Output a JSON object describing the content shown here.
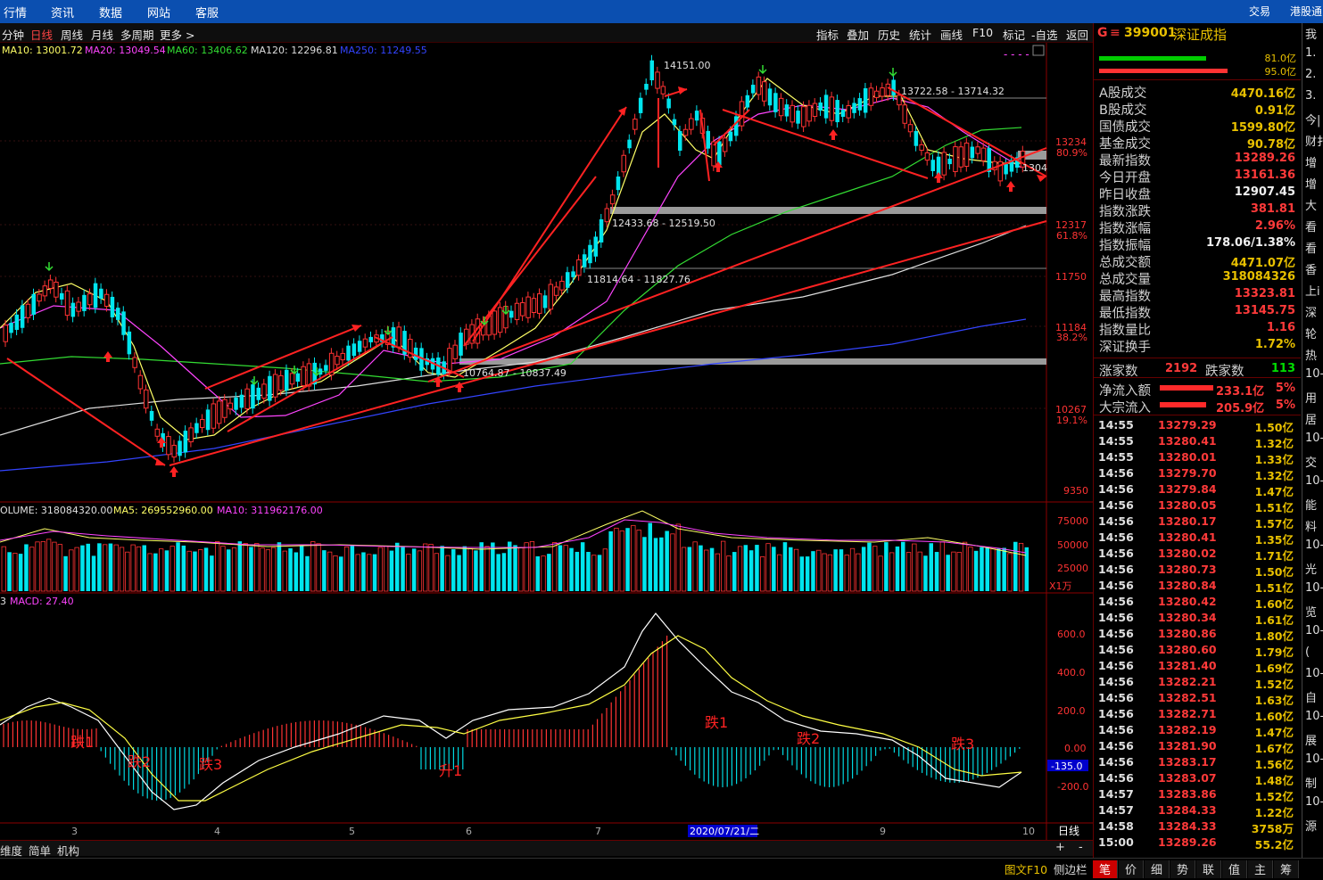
{
  "top_menu": [
    "行情",
    "资讯",
    "数据",
    "网站",
    "客服"
  ],
  "top_menu_right": [
    "交易",
    "港股通"
  ],
  "periods": [
    "分钟",
    "日线",
    "周线",
    "月线",
    "多周期",
    "更多 >"
  ],
  "active_period": "日线",
  "toolbar_right": [
    "指标",
    "叠加",
    "历史",
    "统计",
    "画线",
    "F10",
    "标记",
    "-自选",
    "返回"
  ],
  "ma_legend": [
    {
      "label": "MA10: 13001.72",
      "color": "#ffff66"
    },
    {
      "label": "MA20: 13049.54",
      "color": "#ff44ff"
    },
    {
      "label": "MA60: 13406.62",
      "color": "#33dd33"
    },
    {
      "label": "MA120: 12296.81",
      "color": "#dddddd"
    },
    {
      "label": "MA250: 11249.55",
      "color": "#3344ff"
    }
  ],
  "price_axis": [
    "13234",
    "12317",
    "11750",
    "11184",
    "10267",
    "9350"
  ],
  "fib_axis": [
    "80.9%",
    "61.8%",
    "38.2%",
    "19.1%"
  ],
  "price_annotations": [
    "14151.00",
    "13722.58 - 13714.32",
    "12433.68 - 12519.50",
    "11814.64 - 11827.76",
    "10764.87 - 10837.49",
    "1304"
  ],
  "volume_legend": [
    {
      "label": "OLUME: 318084320.00",
      "color": "#e0e0e0"
    },
    {
      "label": "MA5: 269552960.00",
      "color": "#ffff66"
    },
    {
      "label": "MA10: 311962176.00",
      "color": "#ff44ff"
    }
  ],
  "volume_axis": [
    "75000",
    "50000",
    "25000"
  ],
  "volume_unit": "X1万",
  "macd_legend": {
    "prefix": "3",
    "label": "MACD: 27.40"
  },
  "macd_axis": [
    "600.0",
    "400.0",
    "200.0",
    "0.00",
    "-200.0"
  ],
  "macd_current": "-135.0",
  "macd_annotations": [
    "跌1",
    "跌2",
    "跌3",
    "升1",
    "跌1",
    "跌2",
    "跌3"
  ],
  "date_axis": [
    "3",
    "4",
    "5",
    "6",
    "7",
    "9",
    "10"
  ],
  "date_cursor": "2020/07/21/二",
  "period_label": "日线",
  "bottom_tabs": [
    "维度",
    "简单",
    "机构"
  ],
  "bottom_right": [
    "+",
    "-"
  ],
  "status_right": [
    "图文F10",
    "侧边栏"
  ],
  "index_header": {
    "prefix": "G",
    "code": "399001",
    "name": "深证成指",
    "bar1": "81.0亿",
    "bar2": "95.0亿"
  },
  "stats": [
    {
      "label": "A股成交",
      "value": "4470.16亿",
      "color": "#e8c000"
    },
    {
      "label": "B股成交",
      "value": "0.91亿",
      "color": "#e8c000"
    },
    {
      "label": "国债成交",
      "value": "1599.80亿",
      "color": "#e8c000"
    },
    {
      "label": "基金成交",
      "value": "90.78亿",
      "color": "#e8c000"
    },
    {
      "label": "最新指数",
      "value": "13289.26",
      "color": "#ff3a3a"
    },
    {
      "label": "今日开盘",
      "value": "13161.36",
      "color": "#ff3a3a"
    },
    {
      "label": "昨日收盘",
      "value": "12907.45",
      "color": "#f0f0f0"
    },
    {
      "label": "指数涨跌",
      "value": "381.81",
      "color": "#ff3a3a"
    },
    {
      "label": "指数涨幅",
      "value": "2.96%",
      "color": "#ff3a3a"
    },
    {
      "label": "指数振幅",
      "value": "178.06/1.38%",
      "color": "#f0f0f0"
    },
    {
      "label": "总成交额",
      "value": "4471.07亿",
      "color": "#e8c000"
    },
    {
      "label": "总成交量",
      "value": "318084326",
      "color": "#e8c000"
    },
    {
      "label": "最高指数",
      "value": "13323.81",
      "color": "#ff3a3a"
    },
    {
      "label": "最低指数",
      "value": "13145.75",
      "color": "#ff3a3a"
    },
    {
      "label": "指数量比",
      "value": "1.16",
      "color": "#ff3a3a"
    },
    {
      "label": "深证换手",
      "value": "1.72%",
      "color": "#e8c000"
    }
  ],
  "updown": {
    "up_label": "涨家数",
    "up": "2192",
    "down_label": "跌家数",
    "down": "113"
  },
  "flows": [
    {
      "label": "净流入额",
      "value": "233.1亿",
      "pct": "5%"
    },
    {
      "label": "大宗流入",
      "value": "205.9亿",
      "pct": "5%"
    }
  ],
  "ticks": [
    {
      "t": "14:55",
      "p": "13279.29",
      "v": "1.50亿"
    },
    {
      "t": "14:55",
      "p": "13280.41",
      "v": "1.32亿"
    },
    {
      "t": "14:55",
      "p": "13280.01",
      "v": "1.33亿"
    },
    {
      "t": "14:56",
      "p": "13279.70",
      "v": "1.32亿"
    },
    {
      "t": "14:56",
      "p": "13279.84",
      "v": "1.47亿"
    },
    {
      "t": "14:56",
      "p": "13280.05",
      "v": "1.51亿"
    },
    {
      "t": "14:56",
      "p": "13280.17",
      "v": "1.57亿"
    },
    {
      "t": "14:56",
      "p": "13280.41",
      "v": "1.35亿"
    },
    {
      "t": "14:56",
      "p": "13280.02",
      "v": "1.71亿"
    },
    {
      "t": "14:56",
      "p": "13280.73",
      "v": "1.50亿"
    },
    {
      "t": "14:56",
      "p": "13280.84",
      "v": "1.51亿"
    },
    {
      "t": "14:56",
      "p": "13280.42",
      "v": "1.60亿"
    },
    {
      "t": "14:56",
      "p": "13280.34",
      "v": "1.61亿"
    },
    {
      "t": "14:56",
      "p": "13280.86",
      "v": "1.80亿"
    },
    {
      "t": "14:56",
      "p": "13280.60",
      "v": "1.79亿"
    },
    {
      "t": "14:56",
      "p": "13281.40",
      "v": "1.69亿"
    },
    {
      "t": "14:56",
      "p": "13282.21",
      "v": "1.52亿"
    },
    {
      "t": "14:56",
      "p": "13282.51",
      "v": "1.63亿"
    },
    {
      "t": "14:56",
      "p": "13282.71",
      "v": "1.60亿"
    },
    {
      "t": "14:56",
      "p": "13282.19",
      "v": "1.47亿"
    },
    {
      "t": "14:56",
      "p": "13281.90",
      "v": "1.67亿"
    },
    {
      "t": "14:56",
      "p": "13283.17",
      "v": "1.56亿"
    },
    {
      "t": "14:56",
      "p": "13283.07",
      "v": "1.48亿"
    },
    {
      "t": "14:57",
      "p": "13283.86",
      "v": "1.52亿"
    },
    {
      "t": "14:57",
      "p": "13284.33",
      "v": "1.22亿"
    },
    {
      "t": "14:58",
      "p": "13284.33",
      "v": "3758万"
    },
    {
      "t": "15:00",
      "p": "13289.26",
      "v": "55.2亿"
    }
  ],
  "right_tabs": [
    "笔",
    "价",
    "细",
    "势",
    "联",
    "值",
    "主",
    "筹"
  ],
  "far_right_text": [
    "我",
    "1.",
    "2.",
    "3.",
    "今|",
    "财扌",
    "增",
    "增",
    "大",
    "看",
    "看",
    "香",
    "上i",
    "深",
    "轮",
    "热",
    "10-",
    "用",
    "居",
    "10-",
    "交",
    "10-",
    "能",
    "料",
    "10-",
    "光",
    "10-",
    "览",
    "10-",
    "(",
    "10-",
    "自",
    "10-",
    "展",
    "10-",
    "制",
    "10-",
    "源"
  ]
}
